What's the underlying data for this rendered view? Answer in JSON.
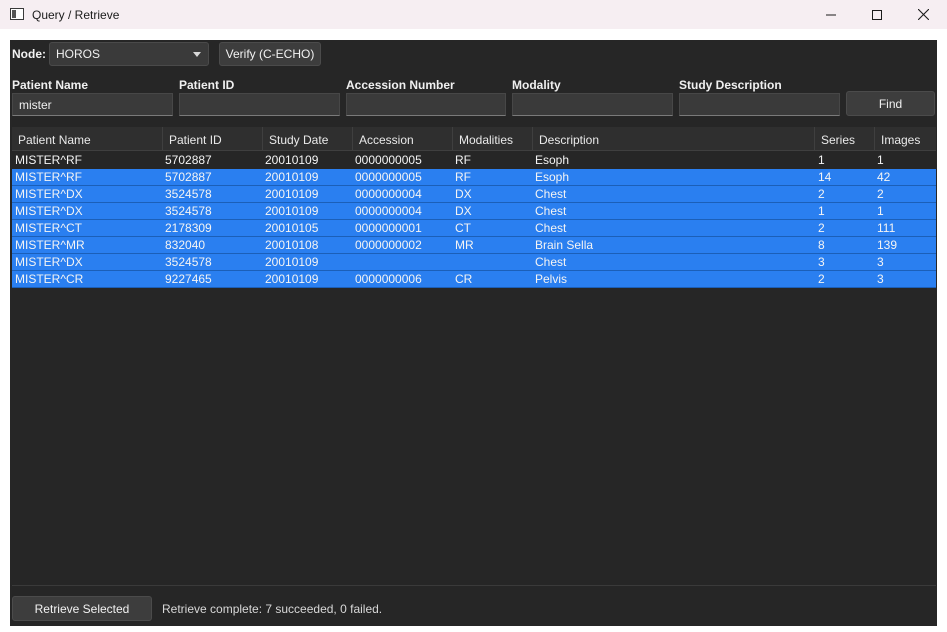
{
  "window": {
    "title": "Query / Retrieve"
  },
  "toolbar": {
    "node_label": "Node:",
    "node_value": "HOROS",
    "verify_label": "Verify (C-ECHO)"
  },
  "search": {
    "patient_name_label": "Patient Name",
    "patient_name_value": "mister",
    "patient_id_label": "Patient ID",
    "patient_id_value": "",
    "accession_label": "Accession Number",
    "accession_value": "",
    "modality_label": "Modality",
    "modality_value": "",
    "description_label": "Study Description",
    "description_value": "",
    "find_label": "Find"
  },
  "table": {
    "columns": [
      "Patient Name",
      "Patient ID",
      "Study Date",
      "Accession",
      "Modalities",
      "Description",
      "Series",
      "Images"
    ],
    "rows": [
      {
        "selected": false,
        "cells": [
          "MISTER^RF",
          "5702887",
          "20010109",
          "0000000005",
          "RF",
          "Esoph",
          "1",
          "1"
        ]
      },
      {
        "selected": true,
        "cells": [
          "MISTER^RF",
          "5702887",
          "20010109",
          "0000000005",
          "RF",
          "Esoph",
          "14",
          "42"
        ]
      },
      {
        "selected": true,
        "cells": [
          "MISTER^DX",
          "3524578",
          "20010109",
          "0000000004",
          "DX",
          "Chest",
          "2",
          "2"
        ]
      },
      {
        "selected": true,
        "cells": [
          "MISTER^DX",
          "3524578",
          "20010109",
          "0000000004",
          "DX",
          "Chest",
          "1",
          "1"
        ]
      },
      {
        "selected": true,
        "cells": [
          "MISTER^CT",
          "2178309",
          "20010105",
          "0000000001",
          "CT",
          "Chest",
          "2",
          "111"
        ]
      },
      {
        "selected": true,
        "cells": [
          "MISTER^MR",
          "832040",
          "20010108",
          "0000000002",
          "MR",
          "Brain Sella",
          "8",
          "139"
        ]
      },
      {
        "selected": true,
        "cells": [
          "MISTER^DX",
          "3524578",
          "20010109",
          "",
          "",
          "Chest",
          "3",
          "3"
        ]
      },
      {
        "selected": true,
        "cells": [
          "MISTER^CR",
          "9227465",
          "20010109",
          "0000000006",
          "CR",
          "Pelvis",
          "2",
          "3"
        ]
      }
    ]
  },
  "footer": {
    "retrieve_label": "Retrieve Selected",
    "status": "Retrieve complete: 7 succeeded, 0 failed."
  },
  "colors": {
    "selection": "#2a7ff0",
    "panel": "#262626"
  }
}
